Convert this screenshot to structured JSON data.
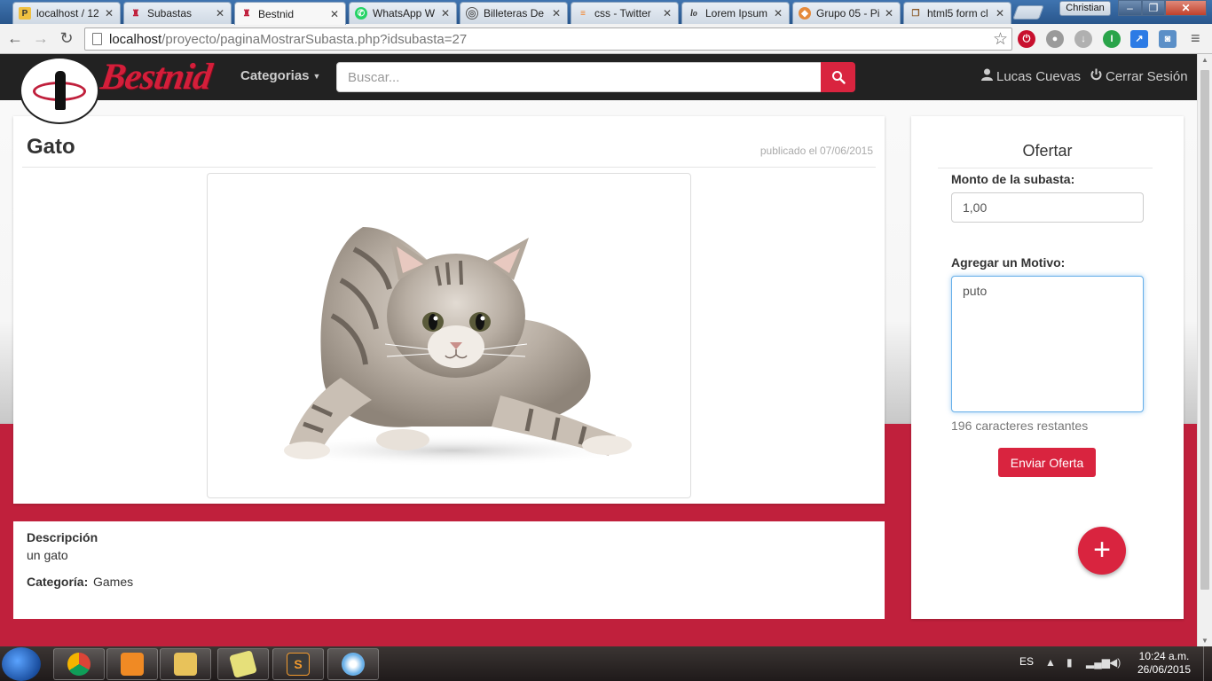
{
  "browser": {
    "tabs": [
      {
        "title": "localhost / 12",
        "active": false
      },
      {
        "title": "Subastas",
        "active": false
      },
      {
        "title": "Bestnid",
        "active": true
      },
      {
        "title": "WhatsApp W",
        "active": false
      },
      {
        "title": "Billeteras De",
        "active": false
      },
      {
        "title": "css - Twitter",
        "active": false
      },
      {
        "title": "Lorem Ipsum",
        "active": false
      },
      {
        "title": "Grupo 05 - Pi",
        "active": false
      },
      {
        "title": "html5 form cl",
        "active": false
      }
    ],
    "profile_name": "Christian",
    "url_host": "localhost",
    "url_path": "/proyecto/paginaMostrarSubasta.php?idsubasta=27"
  },
  "navbar": {
    "brand": "Bestnid",
    "categories_label": "Categorias",
    "search_placeholder": "Buscar...",
    "user_name": "Lucas Cuevas",
    "logout_label": "Cerrar Sesión"
  },
  "auction": {
    "title": "Gato",
    "published_label": "publicado el",
    "published_date": "07/06/2015",
    "image_alt": "gato",
    "description_label": "Descripción",
    "description": "un gato",
    "category_label": "Categoría:",
    "category": "Games"
  },
  "offer": {
    "heading": "Ofertar",
    "amount_label": "Monto de la subasta:",
    "amount_value": "1,00",
    "reason_label": "Agregar un Motivo:",
    "reason_value": "puto",
    "chars_remaining": "196",
    "chars_remaining_suffix": "caracteres restantes",
    "submit_label": "Enviar Oferta",
    "fab_symbol": "+"
  },
  "taskbar": {
    "language": "ES",
    "time": "10:24 a.m.",
    "date": "26/06/2015"
  },
  "colors": {
    "accent_red": "#d9243f",
    "band_red": "#c0203c",
    "navbar_bg": "#222222"
  }
}
